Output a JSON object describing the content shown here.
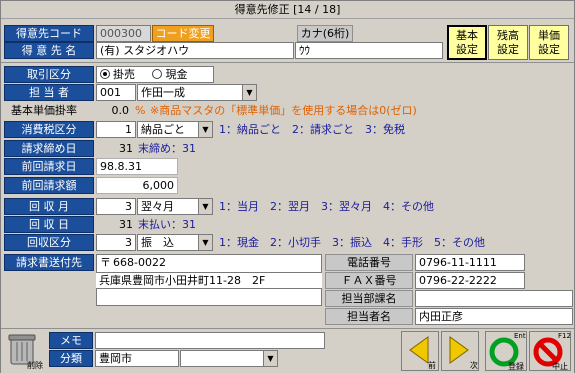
{
  "window": {
    "title": "得意先修正 [14 / 18]"
  },
  "header": {
    "code_label": "得意先コード",
    "code_value": "000300",
    "code_change_button": "コード変更",
    "kana_label": "カナ(6桁)",
    "kana_value": "ｳｳ",
    "name_label": "得 意 先 名",
    "name_value": "(有) スタジオハウ"
  },
  "setting_buttons": [
    {
      "line1": "基本",
      "line2": "設定"
    },
    {
      "line1": "残高",
      "line2": "設定"
    },
    {
      "line1": "単価",
      "line2": "設定"
    }
  ],
  "form": {
    "torihiki_label": "取引区分",
    "torihiki_options": [
      "掛売",
      "現金"
    ],
    "torihiki_selected": "掛売",
    "tanto_label": "担 当 者",
    "tanto_code": "001",
    "tanto_name": "作田一成",
    "kihon_label": "基本単価掛率",
    "kihon_value": "0.0",
    "kihon_unit": "%",
    "kihon_note": "※商品マスタの「標準単価」を使用する場合は0(ゼロ)",
    "shohizei_label": "消費税区分",
    "shohizei_value": "1",
    "shohizei_select": "納品ごと",
    "shohizei_help": "1：納品ごと　2：請求ごと　3：免税",
    "shime_label": "請求締め日",
    "shime_value": "31",
    "shime_text": "末締め：31",
    "zenkai_label": "前回請求日",
    "zenkai_value": "98.8.31",
    "zenkaigaku_label": "前回請求額",
    "zenkaigaku_value": "6,000",
    "kaishu_label": "回 収 月",
    "kaishu_value": "3",
    "kaishu_select": "翌々月",
    "kaishu_help": "1：当月　2：翌月　3：翌々月　4：その他",
    "kaishubi_label": "回 収 日",
    "kaishubi_value": "31",
    "kaishubi_text": "末払い：31",
    "kaishukubun_label": "回収区分",
    "kaishukubun_value": "3",
    "kaishukubun_select": "振　込",
    "kaishukubun_help": "1：現金　2：小切手　3：振込　4：手形　5：その他"
  },
  "address": {
    "label": "請求書送付先",
    "postal_mark": "〒",
    "postal": "668-0022",
    "line1": "兵庫県豊岡市小田井町11-28　2F",
    "line2": ""
  },
  "contact": {
    "tel_label": "電話番号",
    "tel_value": "0796-11-1111",
    "fax_label": "ＦＡＸ番号",
    "fax_value": "0796-22-2222",
    "dept_label": "担当部課名",
    "dept_value": "",
    "person_label": "担当者名",
    "person_value": "内田正彦"
  },
  "bottom": {
    "trash_label": "削除",
    "memo_label": "メモ",
    "memo_value": "",
    "bunrui_label": "分類",
    "bunrui_value": "豊岡市",
    "bunrui_select": "",
    "prev_label": "前",
    "next_label": "次",
    "save_label": "登録",
    "save_key": "Ent",
    "cancel_label": "中止",
    "cancel_key": "F12"
  }
}
